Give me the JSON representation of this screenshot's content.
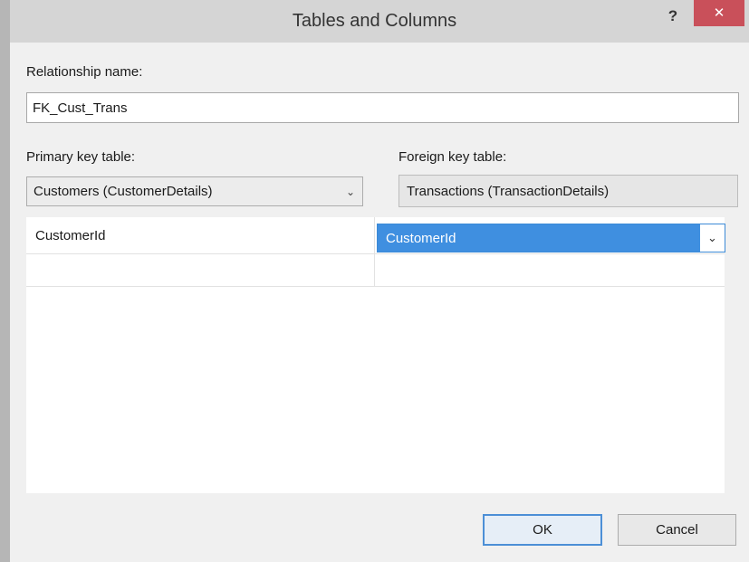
{
  "window": {
    "title": "Tables and Columns",
    "help_glyph": "?",
    "close_glyph": "✕"
  },
  "relationship": {
    "label": "Relationship name:",
    "value": "FK_Cust_Trans"
  },
  "primary_key": {
    "label": "Primary key table:",
    "selected": "Customers (CustomerDetails)",
    "arrow": "⌄"
  },
  "foreign_key": {
    "label": "Foreign key table:",
    "value": "Transactions (TransactionDetails)"
  },
  "columns": {
    "rows": [
      {
        "primary": "CustomerId",
        "foreign": "CustomerId"
      },
      {
        "primary": "",
        "foreign": ""
      }
    ],
    "arrow": "⌄"
  },
  "buttons": {
    "ok": "OK",
    "cancel": "Cancel"
  },
  "colors": {
    "title_bar": "#d5d5d5",
    "close_button": "#c9505a",
    "selection": "#3f8fe0",
    "dialog_body": "#f0f0f0"
  }
}
